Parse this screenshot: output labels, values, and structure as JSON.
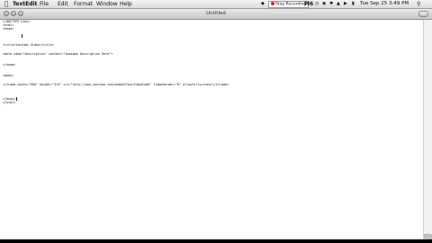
{
  "menubar": {
    "apple_glyph": "",
    "items": [
      {
        "label": "TextEdit",
        "bold": true
      },
      {
        "label": "File",
        "bold": false
      },
      {
        "label": "Edit",
        "bold": false
      },
      {
        "label": "Format",
        "bold": false
      },
      {
        "label": "Window",
        "bold": false
      },
      {
        "label": "Help",
        "bold": false
      }
    ],
    "recording_label": "Stop Recording",
    "m6_label": "M6",
    "clock": "Tue Sep 25  3:49 PM"
  },
  "window": {
    "title": "Untitled"
  },
  "document": {
    "lines": [
      "<!DOCTYPE html>",
      "<html>",
      "<head>",
      "",
      "<title>Youtube Video</title>",
      "",
      "<meta name=\"description\" content=\"Awesome Description Here\">",
      "",
      "</head>",
      "",
      "<body>",
      "",
      "<iframe width=\"560\" height=\"315\" src=\"http://www.youtube.com/embed/YourVideoCode\" frameborder=\"0\" allowfullscreen></iframe>",
      "",
      "",
      "</body>",
      "</html>"
    ]
  }
}
